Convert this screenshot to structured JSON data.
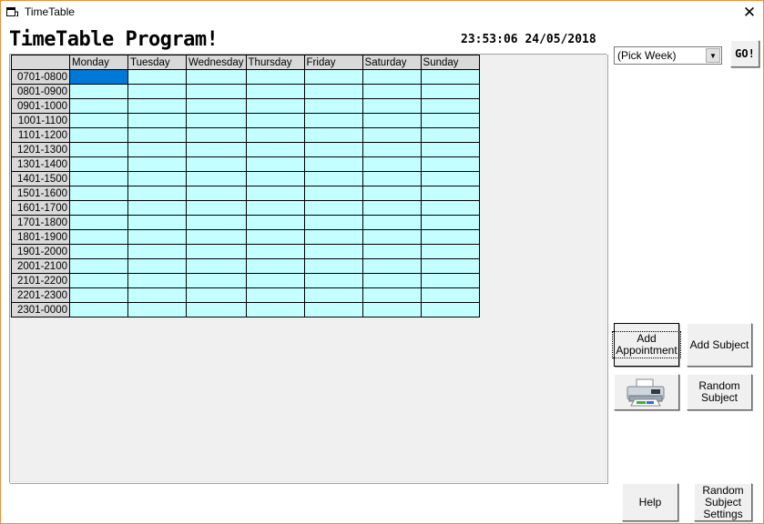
{
  "window": {
    "title": "TimeTable",
    "close_glyph": "✕"
  },
  "header": {
    "program_title": "TimeTable Program!",
    "clock": "23:53:06  24/05/2018"
  },
  "timetable": {
    "days": [
      "Monday",
      "Tuesday",
      "Wednesday",
      "Thursday",
      "Friday",
      "Saturday",
      "Sunday"
    ],
    "time_slots": [
      "0701-0800",
      "0801-0900",
      "0901-1000",
      "1001-1100",
      "1101-1200",
      "1201-1300",
      "1301-1400",
      "1401-1500",
      "1501-1600",
      "1601-1700",
      "1701-1800",
      "1801-1900",
      "1901-2000",
      "2001-2100",
      "2101-2200",
      "2201-2300",
      "2301-0000"
    ],
    "selected_cell": {
      "row": 0,
      "col": 0
    },
    "cell_color": "#c4ffff",
    "selected_color": "#0078d7"
  },
  "controls": {
    "week_select_value": "(Pick Week)",
    "go_label": "GO!",
    "add_appointment_label": "Add Appointment",
    "add_subject_label": "Add Subject",
    "print_icon": "printer-icon",
    "random_subject_label": "Random Subject",
    "help_label": "Help",
    "random_subject_settings_label": "Random Subject Settings"
  }
}
